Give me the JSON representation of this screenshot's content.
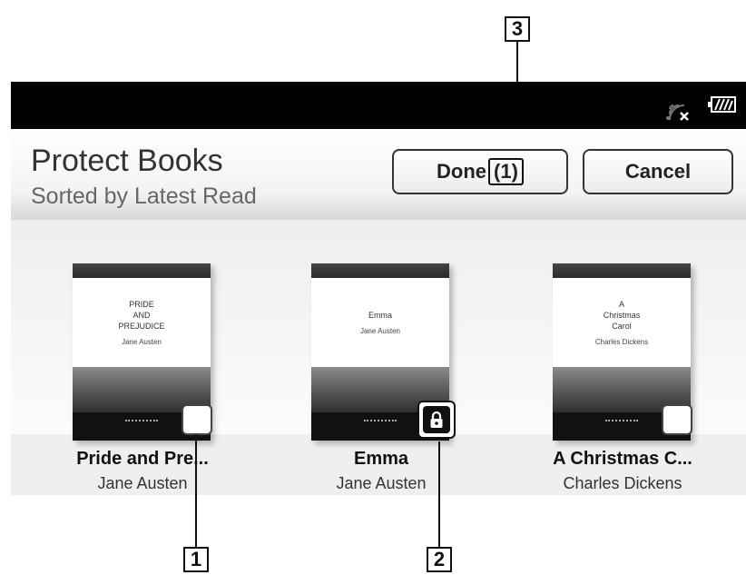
{
  "callouts": [
    "1",
    "2",
    "3"
  ],
  "header": {
    "title": "Protect Books",
    "subtitle": "Sorted by Latest Read",
    "done_label": "Done",
    "done_count": "(1)",
    "cancel_label": "Cancel"
  },
  "status_icons": [
    "wireless-off-icon",
    "battery-icon"
  ],
  "books": [
    {
      "title": "Pride and Pre...",
      "author": "Jane Austen",
      "cover_title": "PRIDE\nAND\nPREJUDICE",
      "cover_author": "Jane Austen",
      "protected": false
    },
    {
      "title": "Emma",
      "author": "Jane Austen",
      "cover_title": "Emma",
      "cover_author": "Jane Austen",
      "protected": true
    },
    {
      "title": "A Christmas C...",
      "author": "Charles Dickens",
      "cover_title": "A\nChristmas\nCarol",
      "cover_author": "Charles Dickens",
      "protected": false
    }
  ],
  "colors": {
    "statusbar": "#000000",
    "page": "#ffffff",
    "border": "#333333"
  }
}
